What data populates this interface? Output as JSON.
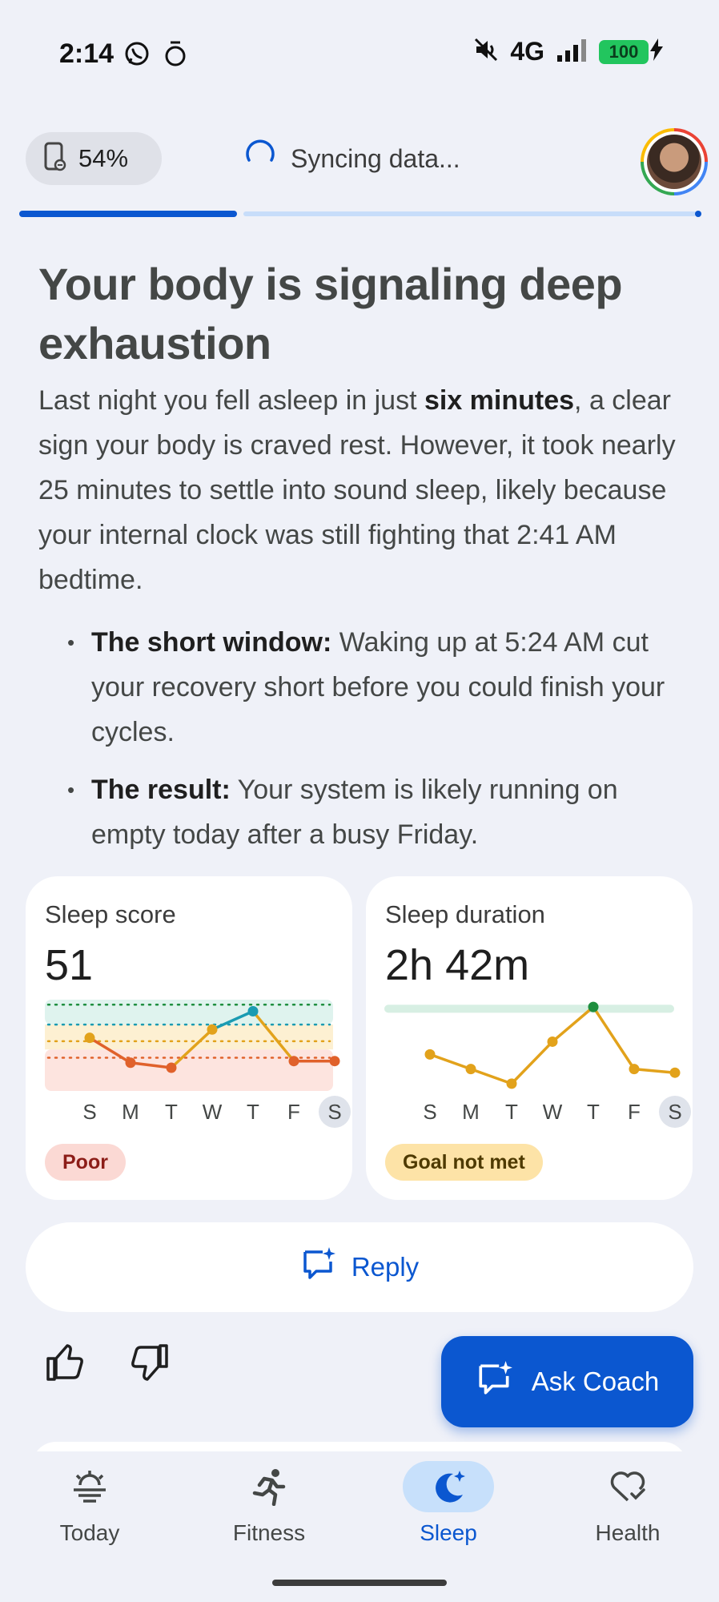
{
  "status_bar": {
    "time": "2:14",
    "network": "4G",
    "battery": "100"
  },
  "header": {
    "watch_battery": "54%",
    "sync_text": "Syncing data...",
    "progress_fraction": 0.32
  },
  "insight": {
    "headline": "Your body is signaling deep exhaustion",
    "para_before": "Last night you fell asleep in just ",
    "para_bold": "six minutes",
    "para_after": ", a clear sign your body is craved rest. However, it took nearly 25 minutes to settle into sound sleep, likely because your internal clock was still fighting that 2:41 AM bedtime.",
    "bullets": [
      {
        "title": "The short window:",
        "text": " Waking up at 5:24 AM cut your recovery short before you could finish your cycles."
      },
      {
        "title": "The result:",
        "text": " Your system is likely running on empty today after a busy Friday."
      }
    ]
  },
  "cards": {
    "sleep_score": {
      "title": "Sleep score",
      "value": "51",
      "badge": "Poor",
      "days": [
        "S",
        "M",
        "T",
        "W",
        "T",
        "F",
        "S"
      ],
      "series": [
        72,
        57,
        54,
        77,
        88,
        58,
        58
      ]
    },
    "sleep_duration": {
      "title": "Sleep duration",
      "value": "2h 42m",
      "badge": "Goal not met",
      "days": [
        "S",
        "M",
        "T",
        "W",
        "T",
        "F",
        "S"
      ],
      "series": [
        5.0,
        4.2,
        3.4,
        5.7,
        7.6,
        4.2,
        4.0
      ]
    }
  },
  "actions": {
    "reply_label": "Reply",
    "ask_coach_label": "Ask Coach"
  },
  "nav": {
    "items": [
      {
        "label": "Today",
        "icon": "sunrise-icon"
      },
      {
        "label": "Fitness",
        "icon": "running-icon"
      },
      {
        "label": "Sleep",
        "icon": "moon-star-icon"
      },
      {
        "label": "Health",
        "icon": "heart-check-icon"
      }
    ],
    "active": "Sleep"
  },
  "colors": {
    "accent": "#0b57d0",
    "score_line_low": "#e0612b",
    "score_line_mid": "#e2a21b",
    "score_line_high": "#1a9bb2",
    "duration_line": "#e2a21b",
    "duration_peak": "#1e8e3e"
  }
}
